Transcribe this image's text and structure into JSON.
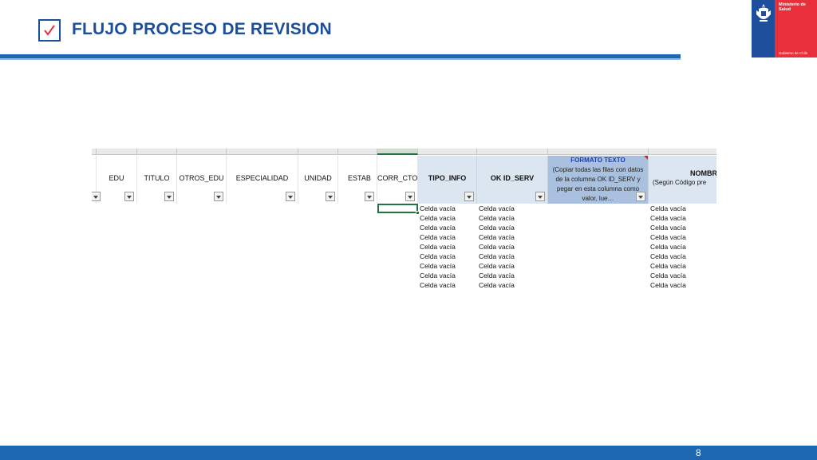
{
  "slide": {
    "title": "FLUJO PROCESO DE REVISION",
    "page_number": "8"
  },
  "logo": {
    "line1": "Ministerio de Salud",
    "line2": "Gobierno de Chile"
  },
  "sheet": {
    "headers": {
      "edu": "EDU",
      "titulo": "TITULO",
      "otros_edu": "OTROS_EDU",
      "especialidad": "ESPECIALIDAD",
      "unidad": "UNIDAD",
      "estab": "ESTAB",
      "corr_cto": "CORR_CTO",
      "tipo_info": "TIPO_INFO",
      "ok_id_serv": "OK ID_SERV",
      "formato_title": "FORMATO TEXTO",
      "formato_body": "(Copiar todas las filas con datos de la columna OK ID_SERV y pegar en esta columna como valor, lue…",
      "nombre_title": "NOMBRE",
      "nombre_sub": "(Según Código pre"
    },
    "empty_cell_text": "Celda vacía",
    "row_count": 9
  }
}
